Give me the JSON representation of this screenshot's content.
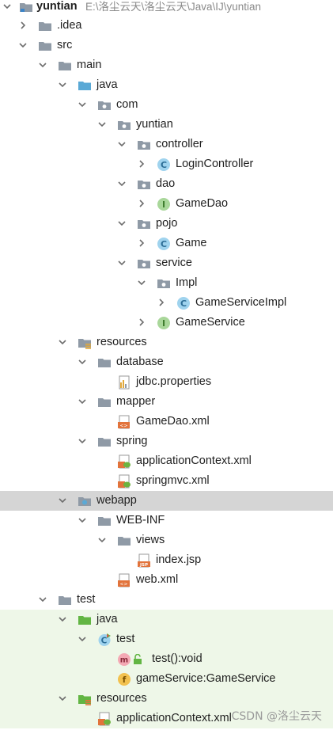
{
  "tree": {
    "root": {
      "label": "yuntian",
      "path": "E:\\洛尘云天\\洛尘云天\\Java\\IJ\\yuntian"
    },
    "nodes": [
      {
        "label": ".idea"
      },
      {
        "label": "src"
      },
      {
        "label": "main"
      },
      {
        "label": "java"
      },
      {
        "label": "com"
      },
      {
        "label": "yuntian"
      },
      {
        "label": "controller"
      },
      {
        "label": "LoginController"
      },
      {
        "label": "dao"
      },
      {
        "label": "GameDao"
      },
      {
        "label": "pojo"
      },
      {
        "label": "Game"
      },
      {
        "label": "service"
      },
      {
        "label": "Impl"
      },
      {
        "label": "GameServiceImpl"
      },
      {
        "label": "GameService"
      },
      {
        "label": "resources"
      },
      {
        "label": "database"
      },
      {
        "label": "jdbc.properties"
      },
      {
        "label": "mapper"
      },
      {
        "label": "GameDao.xml"
      },
      {
        "label": "spring"
      },
      {
        "label": "applicationContext.xml"
      },
      {
        "label": "springmvc.xml"
      },
      {
        "label": "webapp"
      },
      {
        "label": "WEB-INF"
      },
      {
        "label": "views"
      },
      {
        "label": "index.jsp"
      },
      {
        "label": "web.xml"
      },
      {
        "label": "test"
      },
      {
        "label": "java"
      },
      {
        "label": "test"
      },
      {
        "label": "test():void"
      },
      {
        "label": "gameService:GameService"
      },
      {
        "label": "resources"
      },
      {
        "label": "applicationContext.xml"
      }
    ],
    "selected_label": "webapp"
  },
  "icons": {
    "class_letter": "C",
    "interface_letter": "I",
    "method_letter": "m",
    "field_letter": "f",
    "jsp_letter": "JSP",
    "xml_letter": "<>"
  },
  "colors": {
    "folder": "#8f9aa6",
    "source_folder": "#5aa9d6",
    "test_folder": "#62b543",
    "class_icon": "#59a8d8",
    "interface_icon": "#79c068",
    "method_icon": "#f4a9b4",
    "field_icon": "#f2c14e",
    "xml_icon": "#e2733b",
    "selected_bg": "#d5d5d5",
    "test_bg": "#eef7e8"
  },
  "watermark": "CSDN @洛尘云天"
}
